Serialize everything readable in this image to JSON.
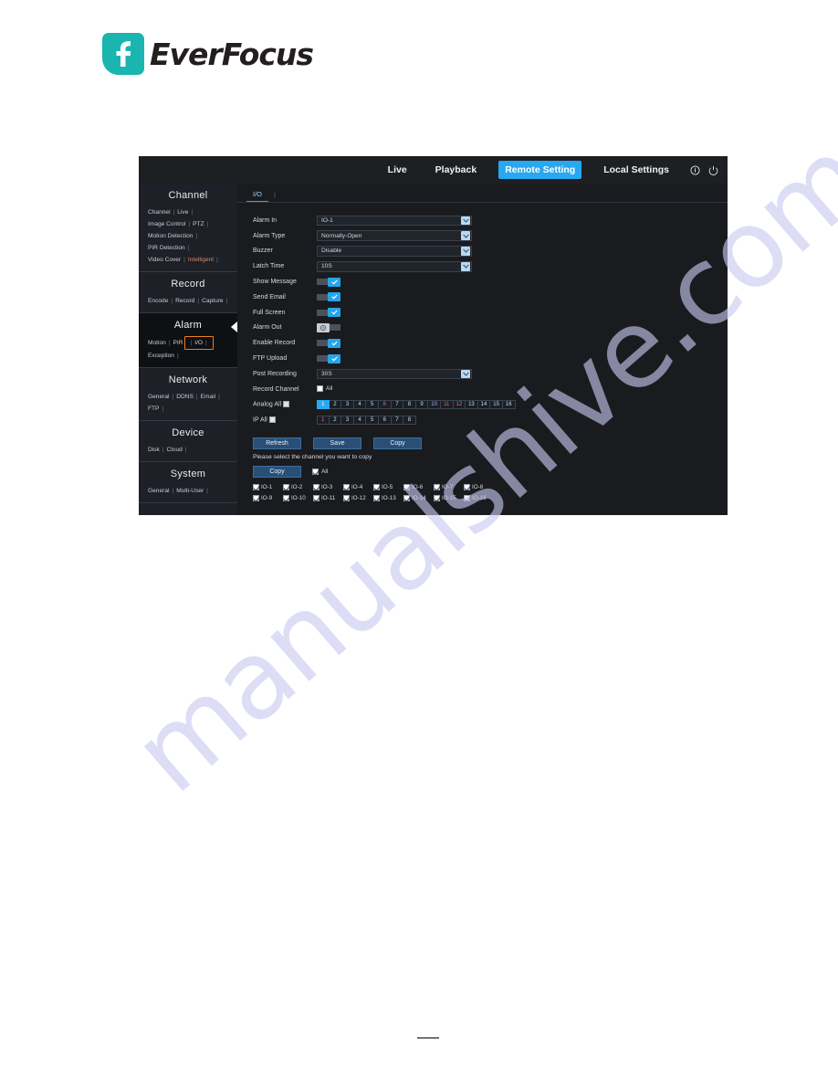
{
  "document": {
    "logo_text": "EverFocus"
  },
  "screenshot": {
    "nav": {
      "items": [
        {
          "label": "Live",
          "active": false
        },
        {
          "label": "Playback",
          "active": false
        },
        {
          "label": "Remote Setting",
          "active": true
        },
        {
          "label": "Local Settings",
          "active": false
        }
      ],
      "icons": [
        "info-icon",
        "power-icon"
      ],
      "active_color": "#28a8f0"
    },
    "sidebar": {
      "sections": [
        {
          "title": "Channel",
          "active": false,
          "rows": [
            [
              {
                "label": "Channel",
                "highlight": false
              },
              {
                "label": "Live",
                "highlight": false
              }
            ],
            [
              {
                "label": "Image Control",
                "highlight": false
              },
              {
                "label": "PTZ",
                "highlight": false
              }
            ],
            [
              {
                "label": "Motion Detection",
                "highlight": false
              }
            ],
            [
              {
                "label": "PIR Detection",
                "highlight": false
              }
            ],
            [
              {
                "label": "Video Cover",
                "highlight": false
              },
              {
                "label": "Intelligent",
                "highlight": true
              }
            ]
          ]
        },
        {
          "title": "Record",
          "active": false,
          "rows": [
            [
              {
                "label": "Encode",
                "highlight": false
              },
              {
                "label": "Record",
                "highlight": false
              },
              {
                "label": "Capture",
                "highlight": false
              }
            ]
          ]
        },
        {
          "title": "Alarm",
          "active": true,
          "rows": [
            [
              {
                "label": "Motion",
                "highlight": false
              },
              {
                "label": "PIR",
                "highlight": false
              },
              {
                "label": "I/O",
                "highlight": false,
                "boxed": true
              }
            ],
            [
              {
                "label": "Exception",
                "highlight": false
              }
            ]
          ]
        },
        {
          "title": "Network",
          "active": false,
          "rows": [
            [
              {
                "label": "General",
                "highlight": false
              },
              {
                "label": "DDNS",
                "highlight": false
              },
              {
                "label": "Email",
                "highlight": false
              }
            ],
            [
              {
                "label": "FTP",
                "highlight": false
              }
            ]
          ]
        },
        {
          "title": "Device",
          "active": false,
          "rows": [
            [
              {
                "label": "Disk",
                "highlight": false
              },
              {
                "label": "Cloud",
                "highlight": false
              }
            ]
          ]
        },
        {
          "title": "System",
          "active": false,
          "rows": [
            [
              {
                "label": "General",
                "highlight": false
              },
              {
                "label": "Multi-User",
                "highlight": false
              }
            ]
          ]
        }
      ],
      "highlight_box_color": "#ef7f1a"
    },
    "content": {
      "tab": "I/O",
      "fields": [
        {
          "label": "Alarm In",
          "type": "select",
          "value": "IO-1"
        },
        {
          "label": "Alarm Type",
          "type": "select",
          "value": "Normally-Open"
        },
        {
          "label": "Buzzer",
          "type": "select",
          "value": "Disable"
        },
        {
          "label": "Latch Time",
          "type": "select",
          "value": "10S"
        },
        {
          "label": "Show Message",
          "type": "toggle",
          "value": "on"
        },
        {
          "label": "Send Email",
          "type": "toggle",
          "value": "on"
        },
        {
          "label": "Full Screen",
          "type": "toggle",
          "value": "on"
        },
        {
          "label": "Alarm Out",
          "type": "toggle",
          "value": "off"
        },
        {
          "label": "Enable Record",
          "type": "toggle",
          "value": "on"
        },
        {
          "label": "FTP Upload",
          "type": "toggle",
          "value": "on"
        },
        {
          "label": "Post Recording",
          "type": "select",
          "value": "30S"
        }
      ],
      "record_channel": {
        "label": "Record Channel",
        "all_label": "All",
        "all_checked": false,
        "analog": {
          "label": "Analog All",
          "checked": false,
          "channels": [
            "1",
            "2",
            "3",
            "4",
            "5",
            "6",
            "7",
            "8",
            "9",
            "10",
            "11",
            "12",
            "13",
            "14",
            "15",
            "16"
          ],
          "selected": [
            "1"
          ]
        },
        "ip": {
          "label": "IP All",
          "checked": false,
          "channels": [
            "1",
            "2",
            "3",
            "4",
            "5",
            "6",
            "7",
            "8"
          ],
          "selected": []
        }
      },
      "buttons": [
        {
          "label": "Refresh"
        },
        {
          "label": "Save"
        },
        {
          "label": "Copy"
        }
      ],
      "copy_hint": "Please select the channel you want to copy",
      "copy_button": "Copy",
      "copy_all_label": "All",
      "copy_all_checked": true,
      "io_targets": [
        {
          "label": "IO-1",
          "checked": true
        },
        {
          "label": "IO-2",
          "checked": true
        },
        {
          "label": "IO-3",
          "checked": true
        },
        {
          "label": "IO-4",
          "checked": true
        },
        {
          "label": "IO-5",
          "checked": true
        },
        {
          "label": "IO-6",
          "checked": true
        },
        {
          "label": "IO-7",
          "checked": true
        },
        {
          "label": "IO-8",
          "checked": true
        },
        {
          "label": "IO-9",
          "checked": true
        },
        {
          "label": "IO-10",
          "checked": true
        },
        {
          "label": "IO-11",
          "checked": true
        },
        {
          "label": "IO-12",
          "checked": true
        },
        {
          "label": "IO-13",
          "checked": true
        },
        {
          "label": "IO-14",
          "checked": true
        },
        {
          "label": "IO-15",
          "checked": true
        },
        {
          "label": "IO-16",
          "checked": true
        }
      ]
    }
  },
  "watermark": {
    "text": "manualshive.com"
  }
}
